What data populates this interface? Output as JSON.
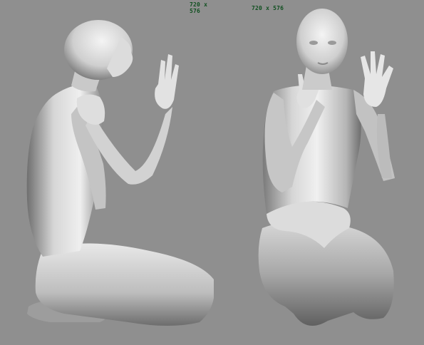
{
  "viewports": {
    "left": {
      "resolution_label": "720 x 576"
    },
    "right": {
      "resolution_label": "720 x 576"
    }
  },
  "colors": {
    "background": "#8f8f8f",
    "label": "#0f4f1f",
    "figure_light": "#e9e9e9",
    "figure_dark": "#7b7b7b"
  }
}
